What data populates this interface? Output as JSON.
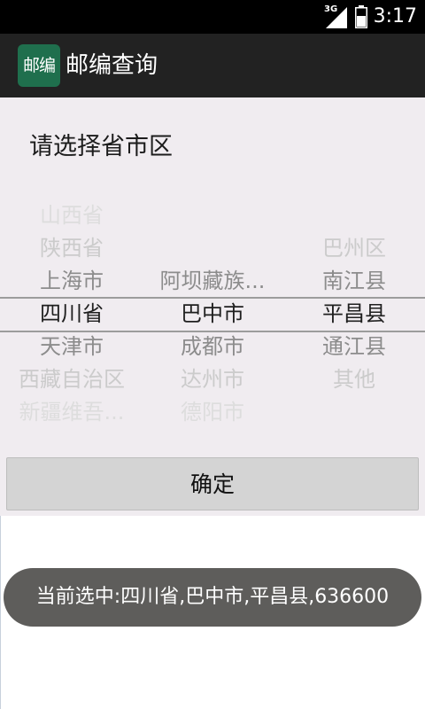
{
  "status_bar": {
    "time": "3:17",
    "network_type": "3G",
    "icons": [
      "signal-icon",
      "battery-icon"
    ]
  },
  "action_bar": {
    "app_icon_text": "邮编",
    "title": "邮编查询",
    "background": "#222222",
    "icon_color": "#1f6f4d"
  },
  "dialog": {
    "title": "请选择省市区",
    "province_wheel": [
      {
        "label": "山西省",
        "offset": -3
      },
      {
        "label": "陕西省",
        "offset": -2
      },
      {
        "label": "上海市",
        "offset": -1
      },
      {
        "label": "四川省",
        "offset": 0
      },
      {
        "label": "天津市",
        "offset": 1
      },
      {
        "label": "西藏自治区",
        "offset": 2
      },
      {
        "label": "新疆维吾...",
        "offset": 3
      }
    ],
    "city_wheel": [
      {
        "label": "阿坝藏族...",
        "offset": -1
      },
      {
        "label": "巴中市",
        "offset": 0
      },
      {
        "label": "成都市",
        "offset": 1
      },
      {
        "label": "达州市",
        "offset": 2
      },
      {
        "label": "德阳市",
        "offset": 3
      }
    ],
    "district_wheel": [
      {
        "label": "巴州区",
        "offset": -2
      },
      {
        "label": "南江县",
        "offset": -1
      },
      {
        "label": "平昌县",
        "offset": 0
      },
      {
        "label": "通江县",
        "offset": 1
      },
      {
        "label": "其他",
        "offset": 2
      }
    ],
    "confirm_label": "确定"
  },
  "toast": {
    "text": "当前选中:四川省,巴中市,平昌县,636600"
  }
}
